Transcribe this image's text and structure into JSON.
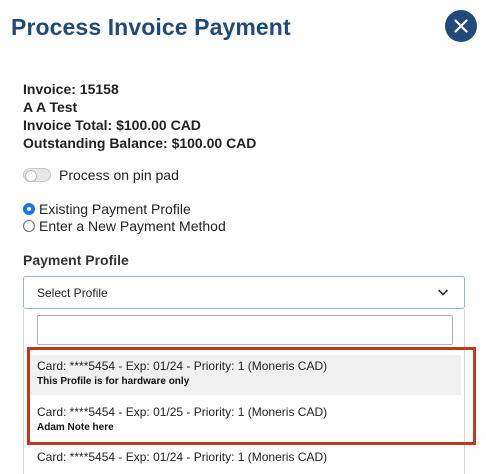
{
  "modal": {
    "title": "Process Invoice Payment",
    "close_icon": "close-icon",
    "accent_color": "#1f4a7a"
  },
  "invoice": {
    "number": "Invoice: 15158",
    "customer": "A A Test",
    "total": "Invoice Total: $100.00 CAD",
    "balance": "Outstanding Balance: $100.00 CAD"
  },
  "pin_pad": {
    "label": "Process on pin pad",
    "enabled": false
  },
  "payment_options": [
    {
      "label": "Existing Payment Profile",
      "selected": true
    },
    {
      "label": "Enter a New Payment Method",
      "selected": false
    }
  ],
  "payment_profile": {
    "label": "Payment Profile",
    "placeholder": "Select Profile",
    "search_value": "",
    "options": [
      {
        "text": "Card: ****5454 - Exp: 01/24 - Priority: 1 (Moneris CAD)",
        "note": "This Profile is for hardware only"
      },
      {
        "text": "Card: ****5454 - Exp: 01/25 - Priority: 1 (Moneris CAD)",
        "note": "Adam Note here"
      },
      {
        "text": "Card: ****5454 - Exp: 01/24 - Priority: 1 (Moneris CAD)",
        "note": ""
      }
    ]
  },
  "annotation": {
    "highlight_color": "#c0391f"
  }
}
